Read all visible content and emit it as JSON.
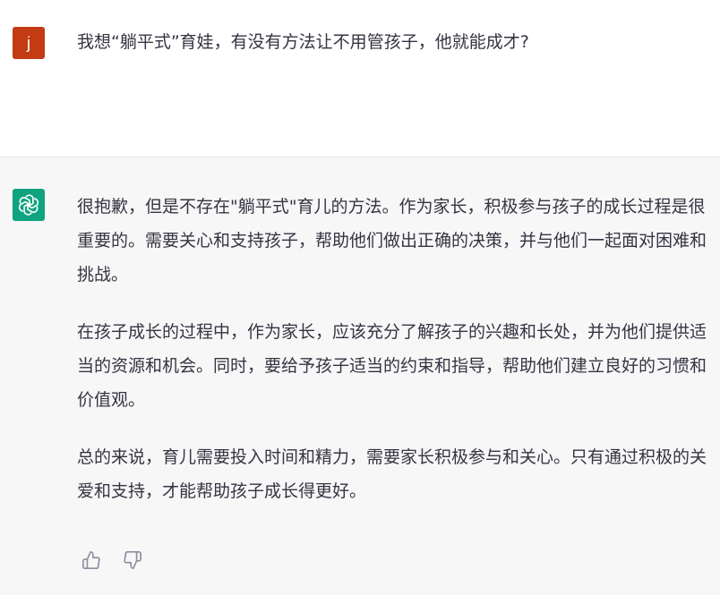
{
  "user": {
    "avatar_letter": "j",
    "avatar_color": "#c23b12",
    "message": "我想“躺平式”育娃，有没有方法让不用管孩子，他就能成才?"
  },
  "assistant": {
    "avatar_icon": "openai-logo-icon",
    "avatar_color": "#10a37f",
    "paragraphs": [
      "很抱歉，但是不存在\"躺平式\"育儿的方法。作为家长，积极参与孩子的成长过程是很重要的。需要关心和支持孩子，帮助他们做出正确的决策，并与他们一起面对困难和挑战。",
      "在孩子成长的过程中，作为家长，应该充分了解孩子的兴趣和长处，并为他们提供适当的资源和机会。同时，要给予孩子适当的约束和指导，帮助他们建立良好的习惯和价值观。",
      "总的来说，育儿需要投入时间和精力，需要家长积极参与和关心。只有通过积极的关爱和支持，才能帮助孩子成长得更好。"
    ]
  },
  "feedback": {
    "thumbs_up_icon": "thumbs-up-icon",
    "thumbs_down_icon": "thumbs-down-icon"
  }
}
